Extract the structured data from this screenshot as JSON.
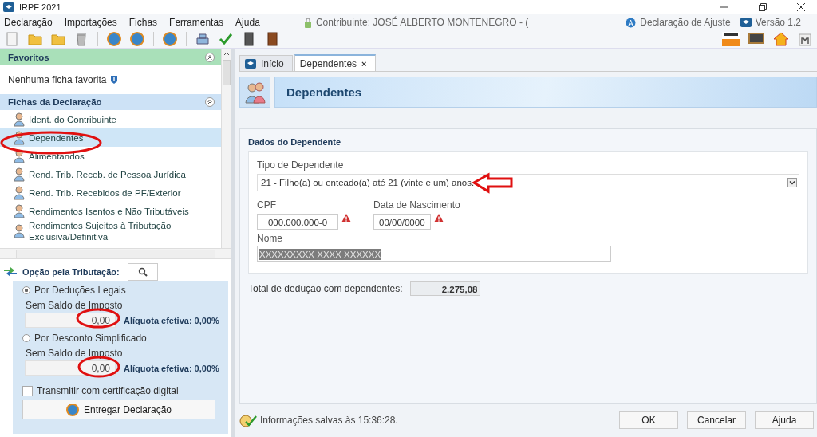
{
  "window": {
    "title": "IRPF 2021"
  },
  "menu": [
    "Declaração",
    "Importações",
    "Fichas",
    "Ferramentas",
    "Ajuda"
  ],
  "info": {
    "contributor": "Contribuinte: JOSÉ ALBERTO MONTENEGRO - (",
    "declaration": "Declaração de Ajuste",
    "version": "Versão 1.2"
  },
  "sidebar": {
    "favorites": {
      "title": "Favoritos",
      "empty_text": "Nenhuma ficha favorita"
    },
    "fichas": {
      "title": "Fichas da Declaração",
      "items": [
        {
          "label": "Ident. do Contribuinte",
          "selected": false
        },
        {
          "label": "Dependentes",
          "selected": true
        },
        {
          "label": "Alimentandos",
          "selected": false
        },
        {
          "label": "Rend. Trib. Receb. de Pessoa Jurídica",
          "selected": false
        },
        {
          "label": "Rend. Trib. Recebidos de PF/Exterior",
          "selected": false
        },
        {
          "label": "Rendimentos Isentos e Não Tributáveis",
          "selected": false
        },
        {
          "label": "Rendimentos Sujeitos à Tributação Exclusiva/Definitiva",
          "selected": false
        }
      ]
    },
    "option": {
      "title": "Opção pela Tributação:",
      "choices": [
        {
          "label": "Por Deduções Legais",
          "selected": true,
          "sublabel": "Sem Saldo de Imposto",
          "value": "0,00",
          "rate": "Alíquota efetiva: 0,00%"
        },
        {
          "label": "Por Desconto Simplificado",
          "selected": false,
          "sublabel": "Sem Saldo de Imposto",
          "value": "0,00",
          "rate": "Alíquota efetiva: 0,00%"
        }
      ]
    },
    "transmit": {
      "label": "Transmitir com certificação digital",
      "checked": false
    },
    "deliver_button": "Entregar Declaração"
  },
  "tabs": [
    {
      "label": "Início",
      "selected": false
    },
    {
      "label": "Dependentes",
      "selected": true,
      "close": "×"
    }
  ],
  "page": {
    "title": "Dependentes",
    "section": "Dados do Dependente",
    "type_label": "Tipo de Dependente",
    "type_value": "21 - Filho(a) ou enteado(a) até 21 (vinte e um) anos.",
    "cpf_label": "CPF",
    "cpf_value": "000.000.000-0",
    "birth_label": "Data de Nascimento",
    "birth_value": "00/00/0000",
    "name_label": "Nome",
    "name_value": "XXXXXXXXX XXXX XXXXXX",
    "total_label": "Total de dedução com dependentes:",
    "total_value": "2.275,08"
  },
  "status": "Informações salvas às 15:36:28.",
  "buttons": [
    "OK",
    "Cancelar",
    "Ajuda"
  ]
}
